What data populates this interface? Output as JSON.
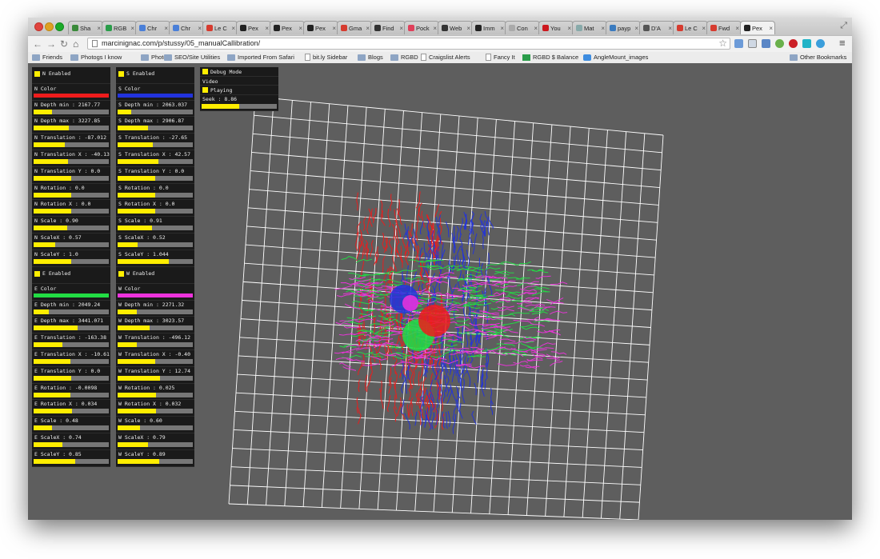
{
  "browser": {
    "tabs": [
      {
        "label": "Sha",
        "icon": "google-drive-icon",
        "color": "#3a8a3a"
      },
      {
        "label": "RGB",
        "icon": "sheets-icon",
        "color": "#2a9d4a"
      },
      {
        "label": "Chr",
        "icon": "chrome-doc-icon",
        "color": "#4a7fd8"
      },
      {
        "label": "Chr",
        "icon": "chrome-doc-icon",
        "color": "#4a7fd8"
      },
      {
        "label": "Le C",
        "icon": "gmail-icon",
        "color": "#d63b2f"
      },
      {
        "label": "Pex",
        "icon": "github-icon",
        "color": "#222222"
      },
      {
        "label": "Pex",
        "icon": "github-icon",
        "color": "#222222"
      },
      {
        "label": "Pex",
        "icon": "github-icon",
        "color": "#222222"
      },
      {
        "label": "Gma",
        "icon": "gmail-icon",
        "color": "#d63b2f"
      },
      {
        "label": "Find",
        "icon": "linux-icon",
        "color": "#333333"
      },
      {
        "label": "Pock",
        "icon": "pocket-icon",
        "color": "#e0405b"
      },
      {
        "label": "Web",
        "icon": "web-icon",
        "color": "#333333"
      },
      {
        "label": "Imm",
        "icon": "imm-icon",
        "color": "#222222"
      },
      {
        "label": "Con",
        "icon": "page-icon",
        "color": "#aaaaaa"
      },
      {
        "label": "You",
        "icon": "youtube-icon",
        "color": "#cc181e"
      },
      {
        "label": "Mat",
        "icon": "settings-icon",
        "color": "#8aa"
      },
      {
        "label": "payp",
        "icon": "paypal-icon",
        "color": "#3b7bbf"
      },
      {
        "label": "D'A",
        "icon": "wikipedia-icon",
        "color": "#555555"
      },
      {
        "label": "Le C",
        "icon": "gmail-icon",
        "color": "#d63b2f"
      },
      {
        "label": "Fwd",
        "icon": "gmail-icon",
        "color": "#d63b2f"
      },
      {
        "label": "Pex",
        "icon": "github-icon",
        "color": "#222222",
        "active": true
      }
    ],
    "tab_close": "×",
    "url": "marcinignac.com/p/stussy/05_manualCallibration/",
    "bookmarks": [
      {
        "label": "Friends",
        "icon": "folder"
      },
      {
        "label": "Photogs I know",
        "icon": "folder"
      },
      {
        "label": "Photo",
        "icon": "folder"
      },
      {
        "label": "SEO/Site Utilities",
        "icon": "folder"
      },
      {
        "label": "Imported From Safari",
        "icon": "folder"
      },
      {
        "label": "bit.ly Sidebar",
        "icon": "page"
      },
      {
        "label": "Blogs",
        "icon": "folder"
      },
      {
        "label": "RGBD",
        "icon": "folder"
      },
      {
        "label": "Craigslist Alerts",
        "icon": "page"
      },
      {
        "label": "Fancy It",
        "icon": "page"
      },
      {
        "label": "RGBD $ Balance",
        "icon": "sheet"
      },
      {
        "label": "AngleMount_images",
        "icon": "dropbox"
      },
      {
        "label": "Other Bookmarks",
        "icon": "folder"
      }
    ]
  },
  "gui": {
    "north": [
      {
        "type": "check",
        "label": "N Enabled"
      },
      {
        "type": "color",
        "label": "N Color",
        "color": "#ee1c1c"
      },
      {
        "type": "slider",
        "label": "N Depth min : 2167.77",
        "fill": 0.24
      },
      {
        "type": "slider",
        "label": "N Depth max : 3227.85",
        "fill": 0.47
      },
      {
        "type": "slider",
        "label": "N Translation : -87.012",
        "fill": 0.42
      },
      {
        "type": "slider",
        "label": "N Translation X : -40.13",
        "fill": 0.46
      },
      {
        "type": "slider",
        "label": "N Translation Y : 0.0",
        "fill": 0.5
      },
      {
        "type": "slider",
        "label": "N Rotation : 0.0",
        "fill": 0.5
      },
      {
        "type": "slider",
        "label": "N Rotation X : 0.0",
        "fill": 0.5
      },
      {
        "type": "slider",
        "label": "N Scale : 0.90",
        "fill": 0.45
      },
      {
        "type": "slider",
        "label": "N ScaleX : 0.57",
        "fill": 0.29
      },
      {
        "type": "slider",
        "label": "N ScaleY : 1.0",
        "fill": 0.5
      }
    ],
    "south": [
      {
        "type": "check",
        "label": "S Enabled"
      },
      {
        "type": "color",
        "label": "S Color",
        "color": "#2233dd"
      },
      {
        "type": "slider",
        "label": "S Depth min : 2063.037",
        "fill": 0.18
      },
      {
        "type": "slider",
        "label": "S Depth max : 2906.87",
        "fill": 0.4
      },
      {
        "type": "slider",
        "label": "S Translation : -27.65",
        "fill": 0.47
      },
      {
        "type": "slider",
        "label": "S Translation X : 42.57",
        "fill": 0.54
      },
      {
        "type": "slider",
        "label": "S Translation Y : 0.0",
        "fill": 0.5
      },
      {
        "type": "slider",
        "label": "S Rotation : 0.0",
        "fill": 0.5
      },
      {
        "type": "slider",
        "label": "S Rotation X : 0.0",
        "fill": 0.5
      },
      {
        "type": "slider",
        "label": "S Scale : 0.91",
        "fill": 0.46
      },
      {
        "type": "slider",
        "label": "S ScaleX : 0.52",
        "fill": 0.27
      },
      {
        "type": "slider",
        "label": "S ScaleY : 1.044",
        "fill": 0.68
      }
    ],
    "east": [
      {
        "type": "check",
        "label": "E Enabled"
      },
      {
        "type": "color",
        "label": "E Color",
        "color": "#22dd44"
      },
      {
        "type": "slider",
        "label": "E Depth min : 2049.24",
        "fill": 0.2
      },
      {
        "type": "slider",
        "label": "E Depth max : 3441.071",
        "fill": 0.58
      },
      {
        "type": "slider",
        "label": "E Translation : -163.38",
        "fill": 0.38
      },
      {
        "type": "slider",
        "label": "E Translation X : -10.61",
        "fill": 0.49
      },
      {
        "type": "slider",
        "label": "E Translation Y : 0.0",
        "fill": 0.5
      },
      {
        "type": "slider",
        "label": "E Rotation : -0.0098",
        "fill": 0.49
      },
      {
        "type": "slider",
        "label": "E Rotation X : 0.034",
        "fill": 0.51
      },
      {
        "type": "slider",
        "label": "E Scale : 0.48",
        "fill": 0.24
      },
      {
        "type": "slider",
        "label": "E ScaleX : 0.74",
        "fill": 0.38
      },
      {
        "type": "slider",
        "label": "E ScaleY : 0.85",
        "fill": 0.55
      }
    ],
    "west": [
      {
        "type": "check",
        "label": "W Enabled"
      },
      {
        "type": "color",
        "label": "W Color",
        "color": "#ee33dd"
      },
      {
        "type": "slider",
        "label": "W Depth min : 2271.32",
        "fill": 0.25
      },
      {
        "type": "slider",
        "label": "W Depth max : 3023.57",
        "fill": 0.43
      },
      {
        "type": "slider",
        "label": "W Translation : -496.12",
        "fill": 0.26
      },
      {
        "type": "slider",
        "label": "W Translation X : -0.40",
        "fill": 0.5
      },
      {
        "type": "slider",
        "label": "W Translation Y : 12.74",
        "fill": 0.56
      },
      {
        "type": "slider",
        "label": "W Rotation : 0.025",
        "fill": 0.51
      },
      {
        "type": "slider",
        "label": "W Rotation X : 0.032",
        "fill": 0.51
      },
      {
        "type": "slider",
        "label": "W Scale : 0.60",
        "fill": 0.3
      },
      {
        "type": "slider",
        "label": "W ScaleX : 0.79",
        "fill": 0.4
      },
      {
        "type": "slider",
        "label": "W ScaleY : 0.89",
        "fill": 0.55
      }
    ],
    "debug": [
      {
        "type": "check",
        "label": "Debug Mode"
      },
      {
        "type": "plain",
        "label": "Video"
      },
      {
        "type": "check",
        "label": "Playing"
      },
      {
        "type": "slider",
        "label": "Seek : 8.86",
        "fill": 0.5
      }
    ]
  },
  "colors": {
    "accent": "#ffee00",
    "north": "#ee1c1c",
    "south": "#2233dd",
    "east": "#22dd44",
    "west": "#ee33dd"
  }
}
